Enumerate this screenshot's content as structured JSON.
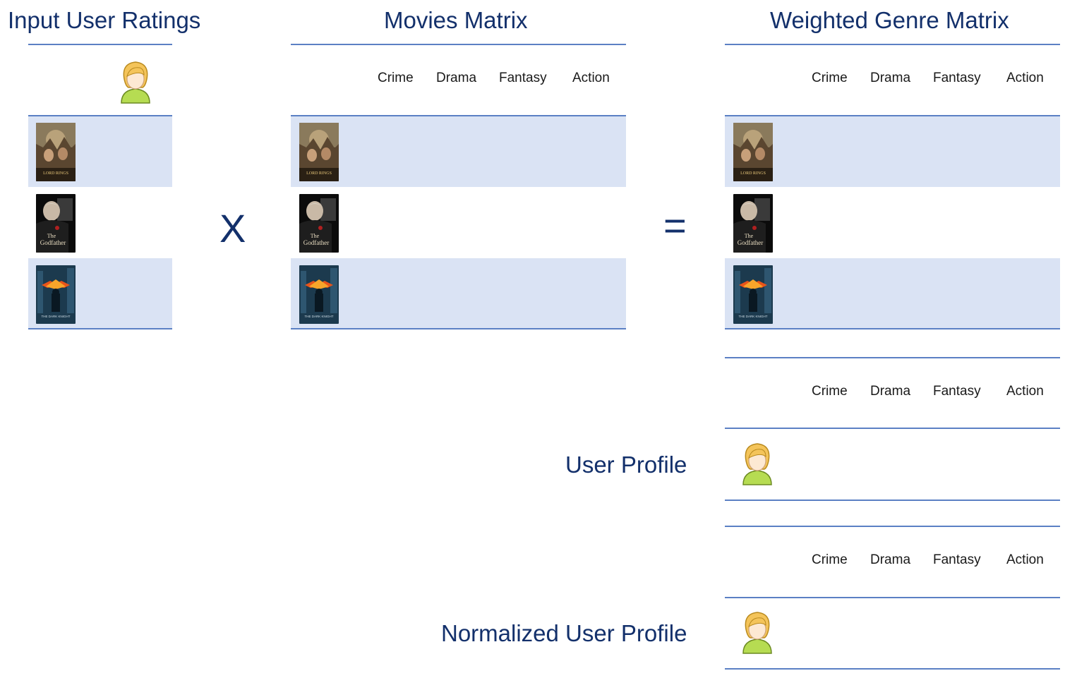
{
  "titles": {
    "input_ratings": "Input User Ratings",
    "movies_matrix": "Movies Matrix",
    "weighted_genre_matrix": "Weighted Genre Matrix",
    "user_profile": "User Profile",
    "normalized_user_profile": "Normalized User Profile"
  },
  "operators": {
    "multiply": "X",
    "equals": "="
  },
  "genres": [
    "Crime",
    "Drama",
    "Fantasy",
    "Action"
  ],
  "movies": [
    {
      "poster": "lord-of-the-rings-poster-icon",
      "poster_text": "LORD RINGS"
    },
    {
      "poster": "godfather-poster-icon",
      "poster_text": "The Godfather"
    },
    {
      "poster": "dark-knight-poster-icon",
      "poster_text": "THE DARK KNIGHT"
    }
  ],
  "icons": {
    "user": "user-avatar-icon"
  },
  "colors": {
    "title": "#13306b",
    "rule": "#5b80c4",
    "band": "#dae3f4"
  }
}
